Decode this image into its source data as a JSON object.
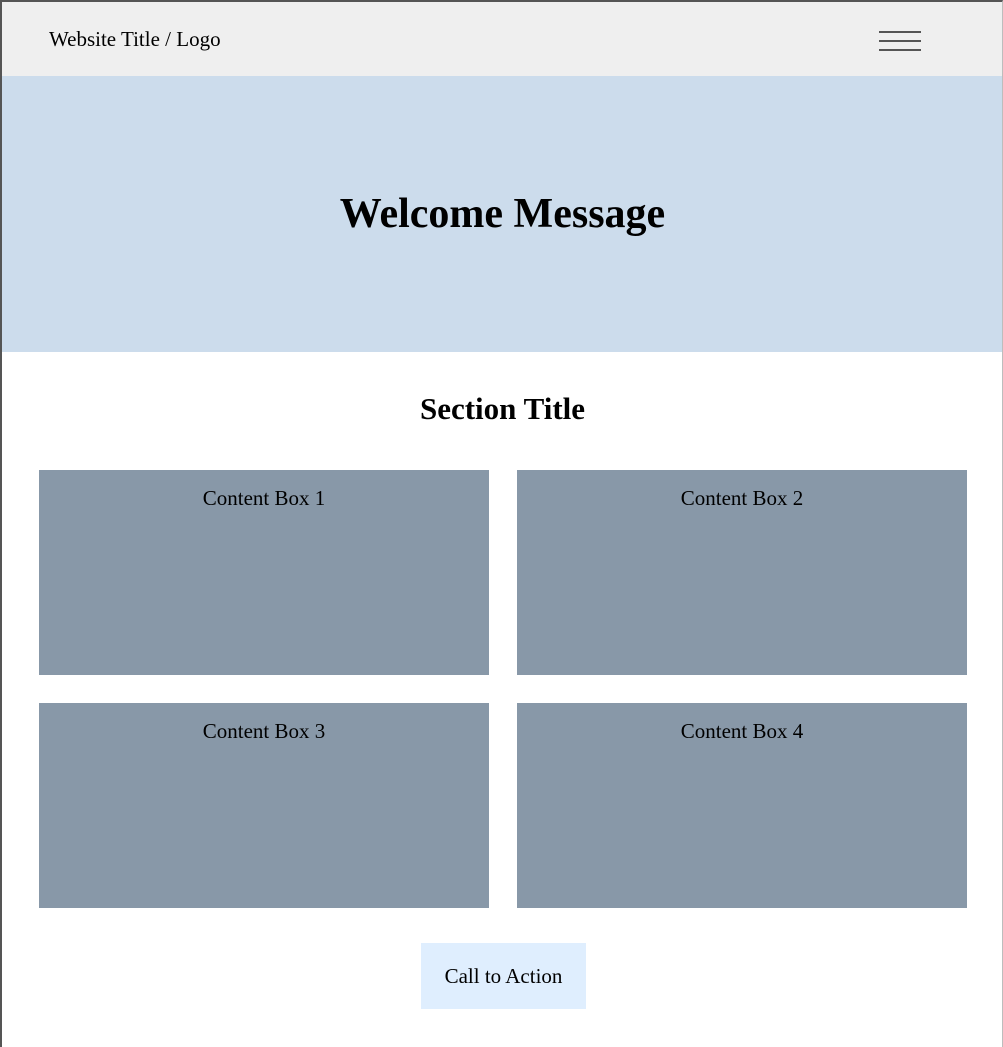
{
  "header": {
    "site_title": "Website Title / Logo",
    "menu_icon": "hamburger-menu-icon"
  },
  "hero": {
    "title": "Welcome Message"
  },
  "section": {
    "title": "Section Title",
    "boxes": [
      {
        "label": "Content Box 1"
      },
      {
        "label": "Content Box 2"
      },
      {
        "label": "Content Box 3"
      },
      {
        "label": "Content Box 4"
      }
    ]
  },
  "cta": {
    "label": "Call to Action"
  },
  "colors": {
    "header_background": "#efefef",
    "hero_background": "#ccdcec",
    "content_box_background": "#8898a8",
    "cta_background": "#dfeefe"
  }
}
